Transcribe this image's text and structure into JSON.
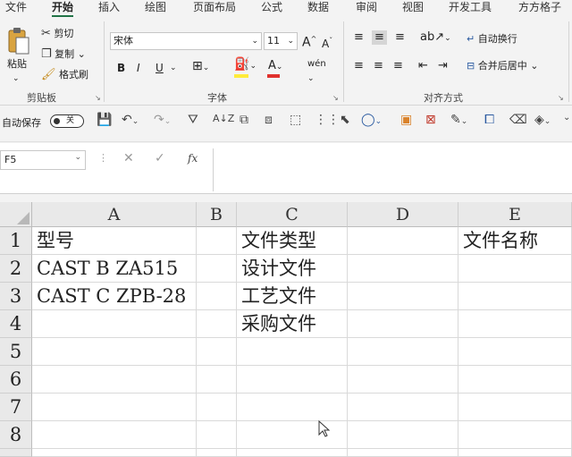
{
  "ribbon_tabs": [
    "文件",
    "开始",
    "插入",
    "绘图",
    "页面布局",
    "公式",
    "数据",
    "审阅",
    "视图",
    "开发工具",
    "方方格子"
  ],
  "clipboard": {
    "paste": "粘贴",
    "cut": "剪切",
    "copy": "复制",
    "format_painter": "格式刷",
    "group_label": "剪贴板"
  },
  "font": {
    "name": "宋体",
    "size": "11",
    "bold": "B",
    "italic": "I",
    "underline": "U",
    "group_label": "字体"
  },
  "alignment": {
    "wrap_text": "自动换行",
    "merge_center": "合并后居中",
    "group_label": "对齐方式"
  },
  "quick_access": {
    "autosave_label": "自动保存",
    "autosave_state": "关"
  },
  "formula_bar": {
    "name_box": "F5",
    "fx": "fx",
    "content": ""
  },
  "grid": {
    "columns": [
      "A",
      "B",
      "C",
      "D",
      "E"
    ],
    "rows": [
      "1",
      "2",
      "3",
      "4",
      "5",
      "6",
      "7",
      "8"
    ],
    "cells": {
      "A1": "型号",
      "A2": "CAST B ZA515",
      "A3": "CAST C ZPB-28",
      "C1": "文件类型",
      "C2": "设计文件",
      "C3": "工艺文件",
      "C4": "采购文件",
      "E1": "文件名称"
    }
  },
  "colors": {
    "accent": "#217346",
    "font_color_bar": "#e0312d",
    "highlight_bar": "#ffeb3b"
  }
}
